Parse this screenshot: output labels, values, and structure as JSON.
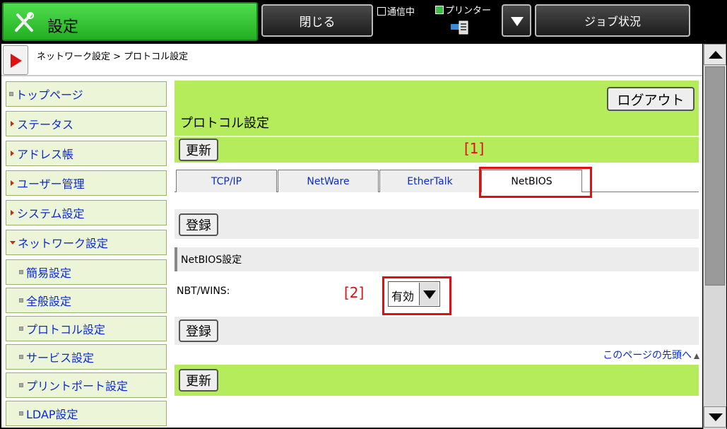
{
  "topbar": {
    "settings_label": "設定",
    "close_label": "閉じる",
    "comm_label": "通信中",
    "printer_label": "プリンター",
    "job_status_label": "ジョブ状況"
  },
  "breadcrumb": "ネットワーク設定 > プロトコル設定",
  "sidebar": {
    "items": [
      {
        "label": "トップページ",
        "marker": "bullet"
      },
      {
        "label": "ステータス",
        "marker": "arrow"
      },
      {
        "label": "アドレス帳",
        "marker": "arrow"
      },
      {
        "label": "ユーザー管理",
        "marker": "arrow"
      },
      {
        "label": "システム設定",
        "marker": "arrow"
      },
      {
        "label": "ネットワーク設定",
        "marker": "arrow-down"
      },
      {
        "label": "簡易設定",
        "marker": "sub"
      },
      {
        "label": "全般設定",
        "marker": "sub"
      },
      {
        "label": "プロトコル設定",
        "marker": "sub"
      },
      {
        "label": "サービス設定",
        "marker": "sub"
      },
      {
        "label": "プリントポート設定",
        "marker": "sub"
      },
      {
        "label": "LDAP設定",
        "marker": "sub"
      }
    ]
  },
  "main": {
    "logout_label": "ログアウト",
    "page_title": "プロトコル設定",
    "update_label": "更新",
    "marker_1": "[1]",
    "marker_2": "[2]",
    "tabs": [
      {
        "label": "TCP/IP",
        "active": false
      },
      {
        "label": "NetWare",
        "active": false
      },
      {
        "label": "EtherTalk",
        "active": false
      },
      {
        "label": "NetBIOS",
        "active": true
      }
    ],
    "register_label": "登録",
    "section_title": "NetBIOS設定",
    "field_label": "NBT/WINS:",
    "field_value": "有効",
    "top_link": "このページの先頭へ"
  },
  "colors": {
    "header_green": "#b4ec5c",
    "nav_bg": "#ecf5d8",
    "link_blue": "#0a2bd0",
    "highlight_red": "#e01010"
  }
}
